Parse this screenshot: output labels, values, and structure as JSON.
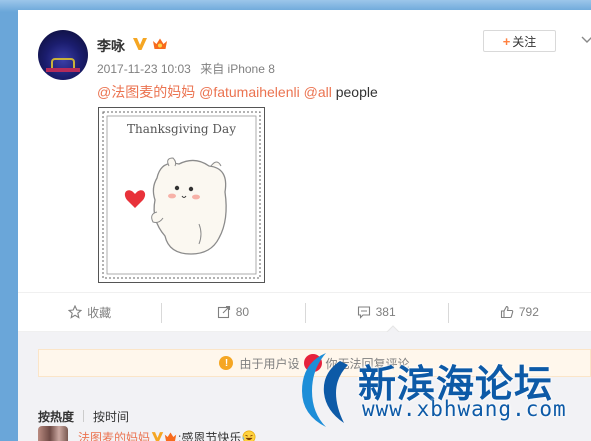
{
  "post": {
    "username": "李咏",
    "timestamp": "2017-11-23 10:03",
    "source": "来自 iPhone 8",
    "follow_label": "关注",
    "mention1": "@法图麦的妈妈",
    "mention2": "@fatumaihelenli",
    "mention3": "@all",
    "text_tail": "people",
    "image_title": "Thanksgiving Day"
  },
  "actions": {
    "favorite_label": "收藏",
    "repost_count": "80",
    "comment_count": "381",
    "like_count": "792"
  },
  "notice": {
    "text_before": "由于用户设",
    "text_after": "你无法回复评论"
  },
  "comments": {
    "sort_hot": "按热度",
    "sort_time": "按时间",
    "first": {
      "name": "法图麦的妈妈",
      "text": ":感恩节快乐"
    }
  },
  "watermark": {
    "cn": "新滨海论坛",
    "url": "www.xbhwang.com"
  },
  "colors": {
    "mention": "#eb7350",
    "page_bg": "#6aa6d9",
    "watermark": "#0d5aa7"
  }
}
